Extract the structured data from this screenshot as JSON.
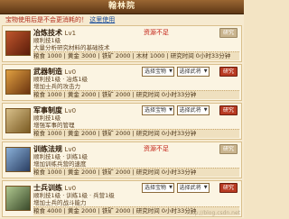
{
  "window": {
    "title": "翰林院"
  },
  "hint": {
    "text": "宝物使用后是不会更消耗的！",
    "link": "这里使用"
  },
  "rows": [
    {
      "name": "冶炼技术",
      "level": "Lv1",
      "desc1": "顺利技1级",
      "desc2": "大量分析研究材料的基础技术",
      "cost": "粮食 1000 | 黄金 3000 | 铁矿 2000 | 木材 1000 | 研究时间 0小时33分钟",
      "status": "资源不足",
      "button": "研究",
      "thumb_color": "#9a2a18"
    },
    {
      "name": "武器制造",
      "level": "Lv0",
      "desc1": "顺利技1级 · 冶炼1级",
      "desc2": "增加士兵的攻击力",
      "cost": "粮食 1000 | 黄金 2000 | 铁矿 2000 | 研究时间 0小时33分钟",
      "select1": "选择宝物",
      "select2": "选择武将",
      "button": "研究",
      "thumb_color": "#7a4a1a"
    },
    {
      "name": "军事制度",
      "level": "Lv0",
      "desc1": "顺利技1级",
      "desc2": "增强军事的管理",
      "cost": "粮食 1000 | 黄金 2000 | 铁矿 2000 | 研究时间 0小时33分钟",
      "select1": "选择宝物",
      "select2": "选择武将",
      "button": "研究",
      "thumb_color": "#6b5a2a"
    },
    {
      "name": "训练法规",
      "level": "Lv0",
      "desc1": "顺利技1级 · 训练1级",
      "desc2": "增加训练兵营的速度",
      "cost": "粮食 1000 | 黄金 2000 | 铁矿 2000 | 研究时间 0小时33分钟",
      "status": "资源不足",
      "button": "研究",
      "thumb_color": "#3a5a8a"
    },
    {
      "name": "士兵训练",
      "level": "Lv0",
      "desc1": "顺利技1级 · 训练1级 · 兵营1级",
      "desc2": "增加士兵的战斗能力",
      "cost": "粮食 4000 | 黄金 2000 | 铁矿 2000 | 研究时间 0小时33分钟",
      "select1": "选择宝物",
      "select2": "选择武将",
      "button": "研究",
      "thumb_color": "#4a6a3a"
    }
  ],
  "watermark": "http://blog.csdn.net"
}
